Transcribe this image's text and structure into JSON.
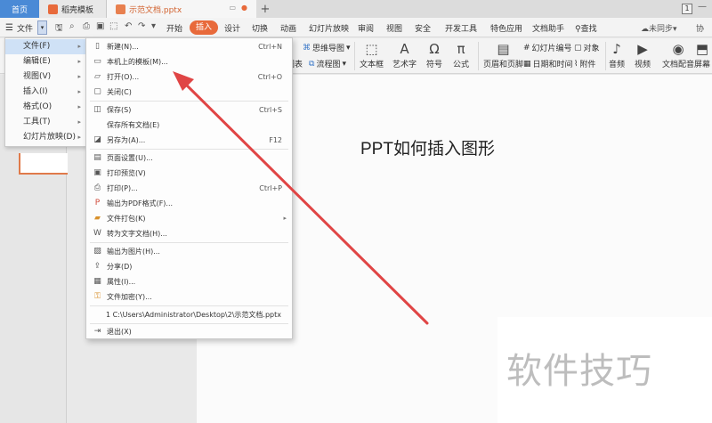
{
  "tabs": {
    "home": "首页",
    "templates": "稻壳模板",
    "document": "示范文档.pptx",
    "add": "+"
  },
  "window": {
    "badge": "1",
    "minimize": "—"
  },
  "menubar": {
    "file": "文件",
    "items": [
      "开始",
      "插入",
      "设计",
      "切换",
      "动画",
      "幻灯片放映",
      "审阅",
      "视图",
      "安全",
      "开发工具",
      "特色应用",
      "文档助手"
    ],
    "active": "插入",
    "search": "查找",
    "sync": "未同步",
    "share": "协"
  },
  "ribbon": {
    "mindmap": "思维导图",
    "flowchart": "流程图",
    "table_frag": "图表",
    "textbox": "文本框",
    "wordart": "艺术字",
    "symbol": "符号",
    "formula": "公式",
    "header_footer": "页眉和页脚",
    "slide_number": "幻灯片编号",
    "object": "对象",
    "date_time": "日期和时间",
    "attachment": "附件",
    "audio": "音频",
    "video": "视频",
    "narration": "文档配音",
    "screenshot": "屏幕"
  },
  "file_menu": {
    "items": [
      {
        "label": "文件(F)",
        "active": true
      },
      {
        "label": "编辑(E)"
      },
      {
        "label": "视图(V)"
      },
      {
        "label": "插入(I)"
      },
      {
        "label": "格式(O)"
      },
      {
        "label": "工具(T)"
      },
      {
        "label": "幻灯片放映(D)"
      }
    ]
  },
  "file_submenu": {
    "items": [
      {
        "label": "新建(N)...",
        "shortcut": "Ctrl+N",
        "icon": "new-doc-icon"
      },
      {
        "label": "本机上的模板(M)...",
        "shortcut": "",
        "icon": "template-icon"
      },
      {
        "label": "打开(O)...",
        "shortcut": "Ctrl+O",
        "icon": "open-folder-icon"
      },
      {
        "label": "关闭(C)",
        "shortcut": "",
        "icon": "close-doc-icon"
      },
      {
        "label": "保存(S)",
        "shortcut": "Ctrl+S",
        "icon": "save-icon"
      },
      {
        "label": "保存所有文档(E)",
        "shortcut": "",
        "icon": ""
      },
      {
        "label": "另存为(A)...",
        "shortcut": "F12",
        "icon": "save-as-icon"
      },
      {
        "label": "页面设置(U)...",
        "shortcut": "",
        "icon": "page-setup-icon"
      },
      {
        "label": "打印预览(V)",
        "shortcut": "",
        "icon": "print-preview-icon"
      },
      {
        "label": "打印(P)...",
        "shortcut": "Ctrl+P",
        "icon": "print-icon"
      },
      {
        "label": "输出为PDF格式(F)...",
        "shortcut": "",
        "icon": "pdf-icon"
      },
      {
        "label": "文件打包(K)",
        "shortcut": "",
        "icon": "package-icon",
        "submenu": true
      },
      {
        "label": "转为文字文档(H)...",
        "shortcut": "",
        "icon": "to-text-icon"
      },
      {
        "label": "输出为图片(H)...",
        "shortcut": "",
        "icon": "export-image-icon"
      },
      {
        "label": "分享(D)",
        "shortcut": "",
        "icon": "share-icon"
      },
      {
        "label": "属性(I)...",
        "shortcut": "",
        "icon": "properties-icon"
      },
      {
        "label": "文件加密(Y)...",
        "shortcut": "",
        "icon": "encrypt-icon"
      },
      {
        "label": "1 C:\\Users\\Administrator\\Desktop\\2\\示范文档.pptx",
        "shortcut": "",
        "icon": ""
      },
      {
        "label": "退出(X)",
        "shortcut": "",
        "icon": "exit-icon"
      }
    ]
  },
  "slide": {
    "title": "PPT如何插入图形"
  },
  "watermark": "软件技巧",
  "colors": {
    "accent": "#e86a3b",
    "home_tab": "#4a8ad6",
    "arrow": "#e04545",
    "menu_highlight": "#cfe1f6"
  }
}
